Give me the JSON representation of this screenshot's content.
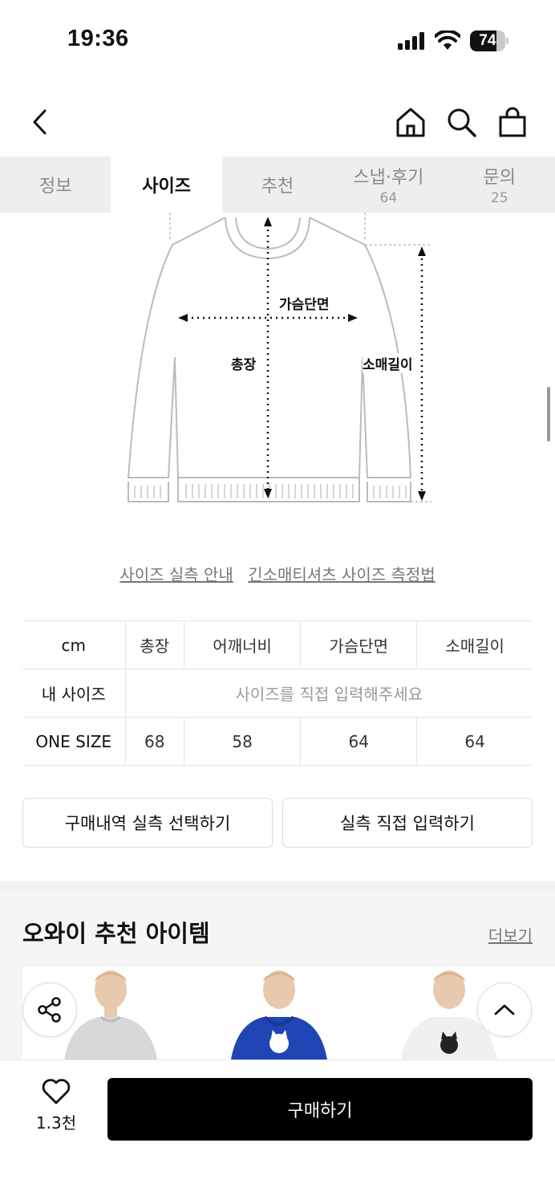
{
  "status_bar": {
    "time": "19:36",
    "battery": "74",
    "battery_level": 0.74
  },
  "tabs": [
    {
      "label": "정보",
      "count": ""
    },
    {
      "label": "사이즈",
      "count": ""
    },
    {
      "label": "추천",
      "count": ""
    },
    {
      "label": "스냅·후기",
      "count": "64"
    },
    {
      "label": "문의",
      "count": "25"
    }
  ],
  "active_tab": "사이즈",
  "diagram": {
    "chest_label": "가슴단면",
    "length_label": "총장",
    "sleeve_label": "소매길이"
  },
  "links": {
    "size_guide": "사이즈 실측 안내",
    "measure_method": "긴소매티셔츠 사이즈 측정법"
  },
  "size_table": {
    "headers": [
      "cm",
      "총장",
      "어깨너비",
      "가슴단면",
      "소매길이"
    ],
    "my_size_label": "내 사이즈",
    "my_size_placeholder": "사이즈를 직접 입력해주세요",
    "rows": [
      {
        "size": "ONE SIZE",
        "values": [
          "68",
          "58",
          "64",
          "64"
        ]
      }
    ]
  },
  "actions": {
    "select_purchase": "구매내역 실측 선택하기",
    "direct_input": "실측 직접 입력하기"
  },
  "recommend": {
    "title": "오와이 추천 아이템",
    "more": "더보기"
  },
  "bottom": {
    "like_count": "1.3천",
    "buy_label": "구매하기"
  }
}
